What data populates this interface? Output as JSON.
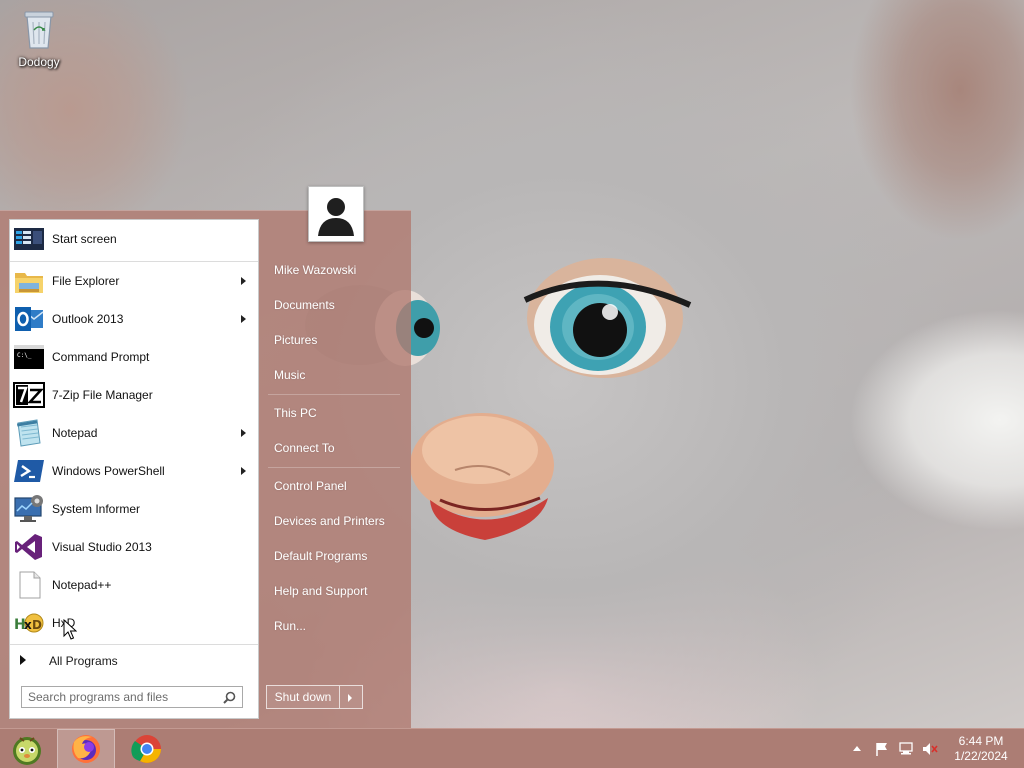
{
  "desktop": {
    "recycle_bin_label": "Dodogy"
  },
  "start_menu": {
    "pinned": [
      {
        "label": "Start screen",
        "icon": "start-screen-icon",
        "has_submenu": false
      },
      {
        "label": "File Explorer",
        "icon": "folder-icon",
        "has_submenu": true
      },
      {
        "label": "Outlook 2013",
        "icon": "outlook-icon",
        "has_submenu": true
      },
      {
        "label": "Command Prompt",
        "icon": "command-prompt-icon",
        "has_submenu": false
      },
      {
        "label": "7-Zip File Manager",
        "icon": "7zip-icon",
        "has_submenu": false
      },
      {
        "label": "Notepad",
        "icon": "notepad-icon",
        "has_submenu": true
      },
      {
        "label": "Windows PowerShell",
        "icon": "powershell-icon",
        "has_submenu": true
      },
      {
        "label": "System Informer",
        "icon": "system-informer-icon",
        "has_submenu": false
      },
      {
        "label": "Visual Studio 2013",
        "icon": "visual-studio-icon",
        "has_submenu": false
      },
      {
        "label": "Notepad++",
        "icon": "notepadpp-icon",
        "has_submenu": false
      },
      {
        "label": "HxD",
        "icon": "hxd-icon",
        "has_submenu": false
      }
    ],
    "all_programs_label": "All Programs",
    "search_placeholder": "Search programs and files",
    "right_links": [
      "Mike Wazowski",
      "Documents",
      "Pictures",
      "Music",
      "This PC",
      "Connect To",
      "Control Panel",
      "Devices and Printers",
      "Default Programs",
      "Help and Support",
      "Run..."
    ],
    "shutdown_label": "Shut down"
  },
  "taskbar": {
    "buttons": [
      "start-orb",
      "firefox",
      "chrome"
    ],
    "active_button": "firefox",
    "time": "6:44 PM",
    "date": "1/22/2024"
  },
  "colors": {
    "menu_bg": "#b07a70",
    "taskbar_bg": "#ac7d74"
  }
}
